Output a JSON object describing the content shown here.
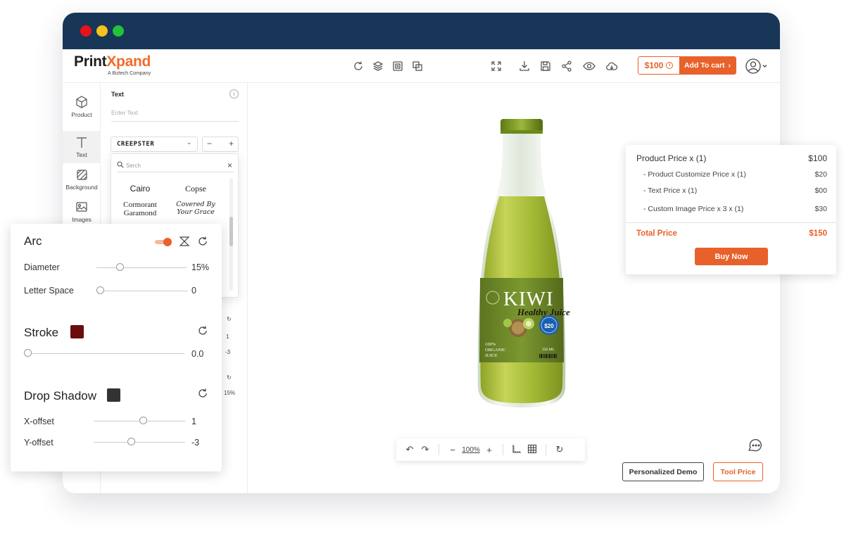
{
  "brand": {
    "name_part1": "Print",
    "name_part2": "Xpand",
    "tagline": "A Biztech Company"
  },
  "colors": {
    "accent": "#e8612a",
    "titlebar": "#183658",
    "stroke": "#6b0d0d",
    "shadow": "#333333"
  },
  "header": {
    "price": "$100",
    "add_to_cart": "Add To cart",
    "icons_left": [
      "refresh-icon",
      "layers-icon",
      "add-page-icon",
      "duplicate-icon"
    ],
    "icons_right": [
      "fullscreen-icon",
      "download-icon",
      "save-icon",
      "share-icon",
      "preview-icon",
      "cloud-icon"
    ]
  },
  "sidebar": {
    "items": [
      {
        "label": "Product",
        "icon": "cube-icon"
      },
      {
        "label": "Text",
        "icon": "text-icon"
      },
      {
        "label": "Background",
        "icon": "background-icon"
      },
      {
        "label": "Images",
        "icon": "image-icon"
      }
    ]
  },
  "text_panel": {
    "title": "Text",
    "input_placeholder": "Enter Text",
    "font_selected": "CREEPSTER",
    "search_placeholder": "Serch",
    "fonts": [
      "Cairo",
      "Copse",
      "Cormorant Garamond",
      "Covered By Your Grace"
    ],
    "partial_values": [
      "1",
      "-3",
      "15%"
    ]
  },
  "zoom": {
    "level": "100%"
  },
  "price_card": {
    "product_label": "Product Price  x  (1)",
    "product_value": "$100",
    "lines": [
      {
        "label": "- Product Customize Price  x  (1)",
        "value": "$20"
      },
      {
        "label": "- Text Price x (1)",
        "value": "$00"
      },
      {
        "label": "- Custom Image Price x 3 x  (1)",
        "value": "$30"
      }
    ],
    "total_label": "Total Price",
    "total_value": "$150",
    "buy_label": "Buy Now"
  },
  "buttons": {
    "demo": "Personalized Demo",
    "tool_price": "Tool Price"
  },
  "props": {
    "arc_title": "Arc",
    "arc_enabled": true,
    "diameter_label": "Diameter",
    "diameter_value": "15%",
    "diameter_level": 0.24,
    "letter_space_label": "Letter Space",
    "letter_space_value": "0",
    "letter_space_level": 0.0,
    "stroke_title": "Stroke",
    "stroke_value": "0.0",
    "stroke_level": 0.0,
    "shadow_title": "Drop Shadow",
    "x_offset_label": "X-offset",
    "x_offset_value": "1",
    "x_offset_level": 0.55,
    "y_offset_label": "Y-offset",
    "y_offset_value": "-3",
    "y_offset_level": 0.4
  },
  "bottle": {
    "brand": "KIWI",
    "tagline": "Healthy Juice",
    "price_badge": "$20",
    "claim_lines": [
      "100%",
      "ORGANIC",
      "JUICE"
    ],
    "volume": "350 ML"
  }
}
